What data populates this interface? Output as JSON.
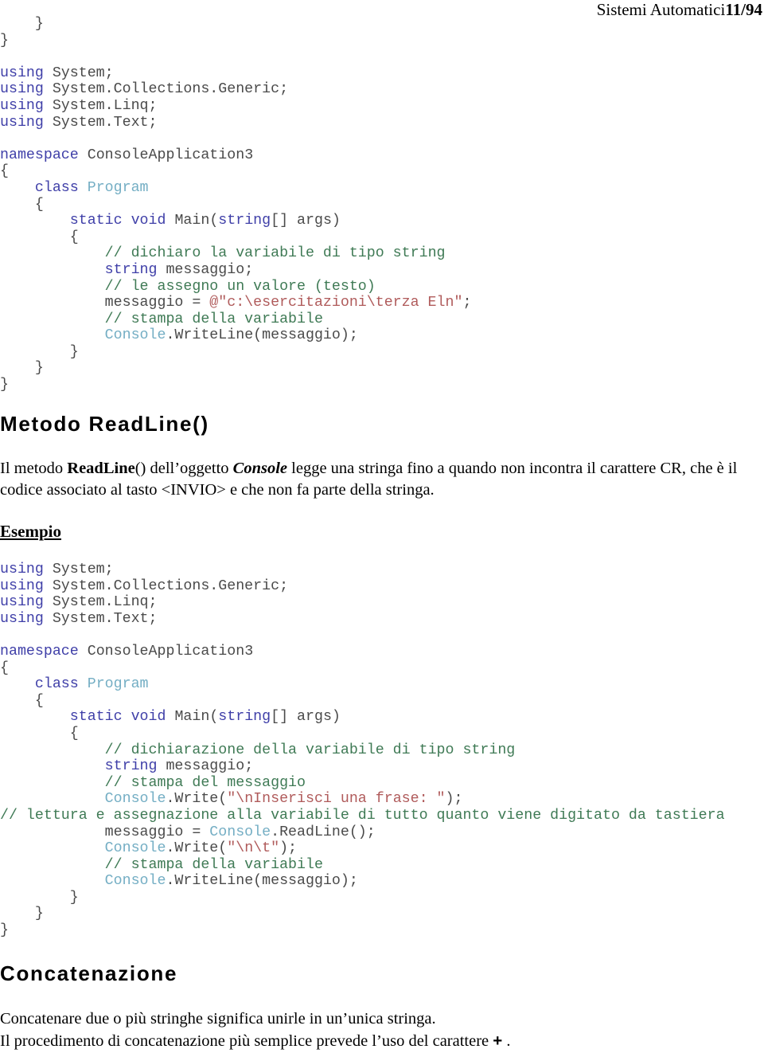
{
  "header": {
    "title": "Sistemi Automatici",
    "page_number": "11/94"
  },
  "code_block_top": {
    "lines": [
      [
        {
          "t": "    }",
          "c": "brc"
        }
      ],
      [
        {
          "t": "}",
          "c": "brc"
        }
      ],
      [
        {
          "t": "",
          "c": "pln"
        }
      ],
      [
        {
          "t": "using",
          "c": "kw"
        },
        {
          "t": " System;",
          "c": "pln"
        }
      ],
      [
        {
          "t": "using",
          "c": "kw"
        },
        {
          "t": " System.Collections.Generic;",
          "c": "pln"
        }
      ],
      [
        {
          "t": "using",
          "c": "kw"
        },
        {
          "t": " System.Linq;",
          "c": "pln"
        }
      ],
      [
        {
          "t": "using",
          "c": "kw"
        },
        {
          "t": " System.Text;",
          "c": "pln"
        }
      ],
      [
        {
          "t": "",
          "c": "pln"
        }
      ],
      [
        {
          "t": "namespace",
          "c": "kw"
        },
        {
          "t": " ConsoleApplication3",
          "c": "pln"
        }
      ],
      [
        {
          "t": "{",
          "c": "brc"
        }
      ],
      [
        {
          "t": "    ",
          "c": "pln"
        },
        {
          "t": "class",
          "c": "kw"
        },
        {
          "t": " ",
          "c": "pln"
        },
        {
          "t": "Program",
          "c": "typ"
        }
      ],
      [
        {
          "t": "    {",
          "c": "brc"
        }
      ],
      [
        {
          "t": "        ",
          "c": "pln"
        },
        {
          "t": "static",
          "c": "kw"
        },
        {
          "t": " ",
          "c": "pln"
        },
        {
          "t": "void",
          "c": "kw"
        },
        {
          "t": " Main(",
          "c": "pln"
        },
        {
          "t": "string",
          "c": "kw"
        },
        {
          "t": "[] args)",
          "c": "pln"
        }
      ],
      [
        {
          "t": "        {",
          "c": "brc"
        }
      ],
      [
        {
          "t": "            ",
          "c": "pln"
        },
        {
          "t": "// dichiaro la variabile di tipo string",
          "c": "cmt"
        }
      ],
      [
        {
          "t": "            ",
          "c": "pln"
        },
        {
          "t": "string",
          "c": "kw"
        },
        {
          "t": " messaggio;",
          "c": "pln"
        }
      ],
      [
        {
          "t": "            ",
          "c": "pln"
        },
        {
          "t": "// le assegno un valore (testo)",
          "c": "cmt"
        }
      ],
      [
        {
          "t": "            messaggio = ",
          "c": "pln"
        },
        {
          "t": "@\"c:\\esercitazioni\\terza Eln\"",
          "c": "str"
        },
        {
          "t": ";",
          "c": "pln"
        }
      ],
      [
        {
          "t": "            ",
          "c": "pln"
        },
        {
          "t": "// stampa della variabile",
          "c": "cmt"
        }
      ],
      [
        {
          "t": "            ",
          "c": "pln"
        },
        {
          "t": "Console",
          "c": "typ"
        },
        {
          "t": ".WriteLine(messaggio);",
          "c": "pln"
        }
      ],
      [
        {
          "t": "        }",
          "c": "brc"
        }
      ],
      [
        {
          "t": "    }",
          "c": "brc"
        }
      ],
      [
        {
          "t": "}",
          "c": "brc"
        }
      ]
    ]
  },
  "section_readline": {
    "heading": "Metodo ReadLine()",
    "paragraph_parts": [
      {
        "t": "Il metodo ",
        "s": "normal"
      },
      {
        "t": "ReadLine",
        "s": "bold"
      },
      {
        "t": "() dell’oggetto ",
        "s": "normal"
      },
      {
        "t": "Console",
        "s": "bolditalic"
      },
      {
        "t": " legge una stringa fino a quando non incontra il carattere CR, che è il codice associato al tasto  <INVIO>  e che non fa parte della stringa.",
        "s": "normal"
      }
    ]
  },
  "esempio": {
    "label": "Esempio"
  },
  "code_block_bottom": {
    "lines": [
      [
        {
          "t": "using",
          "c": "kw"
        },
        {
          "t": " System;",
          "c": "pln"
        }
      ],
      [
        {
          "t": "using",
          "c": "kw"
        },
        {
          "t": " System.Collections.Generic;",
          "c": "pln"
        }
      ],
      [
        {
          "t": "using",
          "c": "kw"
        },
        {
          "t": " System.Linq;",
          "c": "pln"
        }
      ],
      [
        {
          "t": "using",
          "c": "kw"
        },
        {
          "t": " System.Text;",
          "c": "pln"
        }
      ],
      [
        {
          "t": "",
          "c": "pln"
        }
      ],
      [
        {
          "t": "namespace",
          "c": "kw"
        },
        {
          "t": " ConsoleApplication3",
          "c": "pln"
        }
      ],
      [
        {
          "t": "{",
          "c": "brc"
        }
      ],
      [
        {
          "t": "    ",
          "c": "pln"
        },
        {
          "t": "class",
          "c": "kw"
        },
        {
          "t": " ",
          "c": "pln"
        },
        {
          "t": "Program",
          "c": "typ"
        }
      ],
      [
        {
          "t": "    {",
          "c": "brc"
        }
      ],
      [
        {
          "t": "        ",
          "c": "pln"
        },
        {
          "t": "static",
          "c": "kw"
        },
        {
          "t": " ",
          "c": "pln"
        },
        {
          "t": "void",
          "c": "kw"
        },
        {
          "t": " Main(",
          "c": "pln"
        },
        {
          "t": "string",
          "c": "kw"
        },
        {
          "t": "[] args)",
          "c": "pln"
        }
      ],
      [
        {
          "t": "        {",
          "c": "brc"
        }
      ],
      [
        {
          "t": "            ",
          "c": "pln"
        },
        {
          "t": "// dichiarazione della variabile di tipo string",
          "c": "cmt"
        }
      ],
      [
        {
          "t": "            ",
          "c": "pln"
        },
        {
          "t": "string",
          "c": "kw"
        },
        {
          "t": " messaggio;",
          "c": "pln"
        }
      ],
      [
        {
          "t": "            ",
          "c": "pln"
        },
        {
          "t": "// stampa del messaggio",
          "c": "cmt"
        }
      ],
      [
        {
          "t": "            ",
          "c": "pln"
        },
        {
          "t": "Console",
          "c": "typ"
        },
        {
          "t": ".Write(",
          "c": "pln"
        },
        {
          "t": "\"\\nInserisci una frase: \"",
          "c": "str"
        },
        {
          "t": ");",
          "c": "pln"
        }
      ],
      [
        {
          "t": "// lettura e assegnazione alla variabile di tutto quanto viene digitato da tastiera",
          "c": "cmt"
        }
      ],
      [
        {
          "t": "            messaggio = ",
          "c": "pln"
        },
        {
          "t": "Console",
          "c": "typ"
        },
        {
          "t": ".ReadLine();",
          "c": "pln"
        }
      ],
      [
        {
          "t": "            ",
          "c": "pln"
        },
        {
          "t": "Console",
          "c": "typ"
        },
        {
          "t": ".Write(",
          "c": "pln"
        },
        {
          "t": "\"\\n\\t\"",
          "c": "str"
        },
        {
          "t": ");",
          "c": "pln"
        }
      ],
      [
        {
          "t": "            ",
          "c": "pln"
        },
        {
          "t": "// stampa della variabile",
          "c": "cmt"
        }
      ],
      [
        {
          "t": "            ",
          "c": "pln"
        },
        {
          "t": "Console",
          "c": "typ"
        },
        {
          "t": ".WriteLine(messaggio);",
          "c": "pln"
        }
      ],
      [
        {
          "t": "        }",
          "c": "brc"
        }
      ],
      [
        {
          "t": "    }",
          "c": "brc"
        }
      ],
      [
        {
          "t": "}",
          "c": "brc"
        }
      ]
    ]
  },
  "section_concat": {
    "heading": "Concatenazione",
    "line1": "Concatenare due o più stringhe significa unirle in un’unica stringa.",
    "line2_prefix": "Il procedimento di concatenazione più semplice prevede l’uso del carattere ",
    "line2_operator": "+",
    "line2_suffix": " ."
  },
  "colors": {
    "keyword": "#3f3fa8",
    "type": "#74aec4",
    "comment": "#3f7a55",
    "string": "#b05b5b",
    "plain": "#4a4a4a",
    "text": "#000000",
    "background": "#ffffff"
  }
}
